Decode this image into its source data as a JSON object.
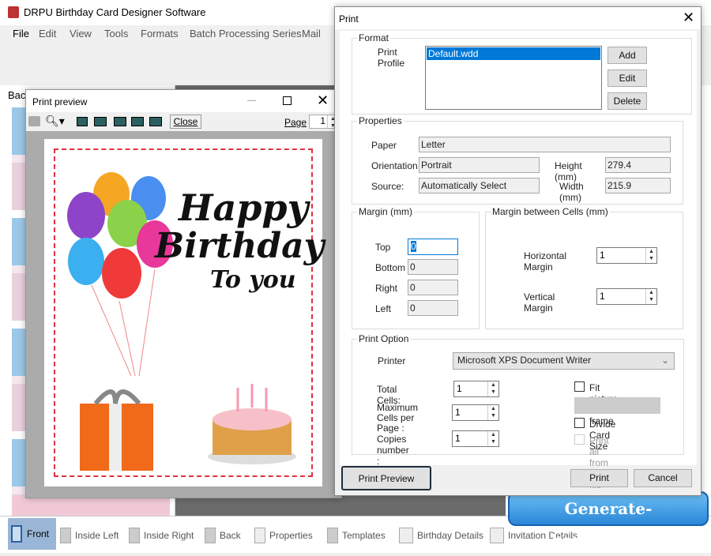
{
  "app": {
    "title": "DRPU Birthday Card Designer Software",
    "menu": [
      "File",
      "Edit",
      "View",
      "Tools",
      "Formats",
      "Batch Processing Series",
      "Mail"
    ],
    "left_panel_label": "Bac",
    "bottom_tabs": [
      "Front",
      "Inside Left",
      "Inside Right",
      "Back",
      "Properties",
      "Templates",
      "Birthday Details",
      "Invitation Details"
    ],
    "watermark": "Generate-barcode.com"
  },
  "preview": {
    "title": "Print preview",
    "close_label": "Close",
    "page_label": "Page",
    "page_value": "1",
    "card": {
      "line1": "Happy",
      "line2": "Birthday",
      "line3": "To you"
    }
  },
  "print": {
    "title": "Print",
    "format": {
      "legend": "Format",
      "profile_label": "Print Profile",
      "profiles": [
        "Default.wdd"
      ],
      "add": "Add",
      "edit": "Edit",
      "delete": "Delete"
    },
    "properties": {
      "legend": "Properties",
      "paper_label": "Paper",
      "paper": "Letter",
      "orientation_label": "Orientation",
      "orientation": "Portrait",
      "source_label": "Source:",
      "source": "Automatically Select",
      "height_label": "Height (mm)",
      "height": "279.4",
      "width_label": "Width (mm)",
      "width": "215.9"
    },
    "margin": {
      "legend": "Margin (mm)",
      "top_label": "Top",
      "top": "0",
      "bottom_label": "Bottom",
      "bottom": "0",
      "right_label": "Right",
      "right": "0",
      "left_label": "Left",
      "left": "0"
    },
    "cells": {
      "legend": "Margin between Cells (mm)",
      "h_label": "Horizontal Margin",
      "h": "1",
      "v_label": "Vertical Margin",
      "v": "1"
    },
    "option": {
      "legend": "Print Option",
      "printer_label": "Printer",
      "printer": "Microsoft XPS Document Writer",
      "total_label": "Total Cells:",
      "total": "1",
      "max_label1": "Maximum",
      "max_label2": "Cells per Page :",
      "max": "1",
      "copies_label": "Copies number :",
      "copies": "1",
      "fit": "Fit picture to frame",
      "divide": "Divide Card Size",
      "excel": "Print all from excel file"
    },
    "preview_btn": "Print Preview",
    "print_btn": "Print",
    "cancel_btn": "Cancel"
  }
}
